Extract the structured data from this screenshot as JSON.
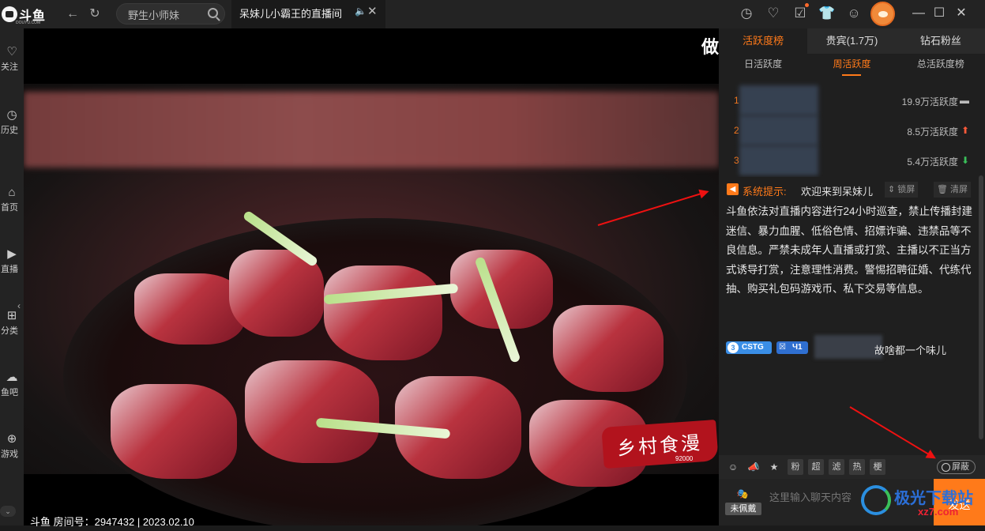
{
  "app": {
    "logo_text": "斗鱼",
    "logo_sub": "DOUYU.COM"
  },
  "nav": {
    "back": "←",
    "refresh": "↻"
  },
  "search": {
    "value": "野生小师妹"
  },
  "tab": {
    "title": "呆妹儿小霸王的直播间",
    "mute": "🔈",
    "close": "✕"
  },
  "toolbar_icons": [
    "clock-icon",
    "heart-icon",
    "calendar-icon",
    "shirt-icon",
    "message-icon",
    "settings-icon"
  ],
  "window": {
    "minimize": "—",
    "maximize": "☐",
    "close": "✕"
  },
  "rail": {
    "items": [
      {
        "icon": "♡",
        "label": "关注"
      },
      {
        "icon": "◷",
        "label": "历史"
      },
      {
        "icon": "⌂",
        "label": "首页"
      },
      {
        "icon": "▶",
        "label": "直播"
      },
      {
        "icon": "⊞",
        "label": "分类"
      },
      {
        "icon": "☁",
        "label": "鱼吧"
      },
      {
        "icon": "⊕",
        "label": "游戏"
      }
    ],
    "collapse": "‹",
    "more": "⌄"
  },
  "video": {
    "overlay_char": "做",
    "stamp_text": "乡村食漫",
    "stamp_num": "92000",
    "caption": "斗鱼 房间号：2947432 | 2023.02.10"
  },
  "panel": {
    "tabs": [
      "活跃度榜",
      "贵宾(1.7万)",
      "钻石粉丝"
    ],
    "sub_tabs": [
      "日活跃度",
      "周活跃度",
      "总活跃度榜"
    ],
    "ranks": [
      {
        "num": "1",
        "value": "19.9万活跃度",
        "trend": "▬",
        "trend_color": "#bbbbbb"
      },
      {
        "num": "2",
        "value": "8.5万活跃度",
        "trend": "⬆",
        "trend_color": "#ff5a3a"
      },
      {
        "num": "3",
        "value": "5.4万活跃度",
        "trend": "⬇",
        "trend_color": "#3ac05a"
      }
    ]
  },
  "chat": {
    "sys_icon": "◀",
    "sys_label": "系统提示:",
    "sys_msg": "欢迎来到呆妹儿",
    "lock_label": "锁屏",
    "clear_label": "清屏",
    "sys_body": "斗鱼依法对直播内容进行24小时巡查，禁止传播封建迷信、暴力血腥、低俗色情、招嫖诈骗、违禁品等不良信息。严禁未成年人直播或打赏、主播以不正当方式诱导打赏，注意理性消费。警惕招聘征婚、代练代抽、购买礼包码游戏币、私下交易等信息。",
    "line": {
      "level": "3",
      "fan_badge": "CSTG",
      "fan_level": "Ч1",
      "text": "故啥都一个味儿"
    }
  },
  "chat_toolbar": {
    "tools": [
      "☺",
      "📣",
      "★",
      "粉",
      "超",
      "滤",
      "热",
      "梗"
    ],
    "shield": "屏蔽"
  },
  "input": {
    "mask": "🎭",
    "wear": "未佩戴",
    "placeholder": "这里输入聊天内容",
    "send": "发送"
  },
  "watermark": {
    "text": "极光下载站",
    "url": "xz7.com"
  }
}
